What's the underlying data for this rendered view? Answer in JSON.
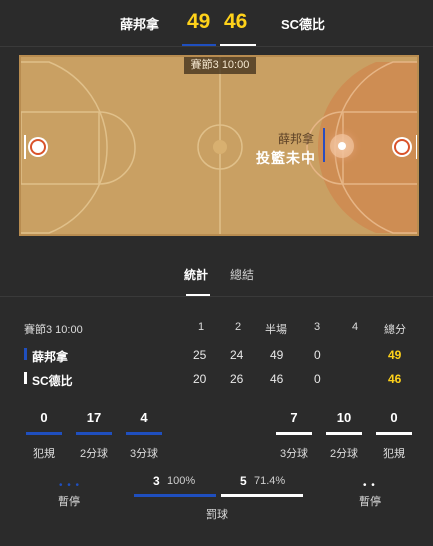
{
  "header": {
    "home_team": "薛邦拿",
    "home_score": "49",
    "away_score": "46",
    "away_team": "SC德比",
    "home_color": "#1f4fbf",
    "away_color": "#ffffff",
    "score_color": "#ffd21a"
  },
  "court": {
    "quarter_tag": "賽節3  10:00",
    "event_team": "薛邦拿",
    "event_text": "投籃未中"
  },
  "tabs": [
    {
      "label": "統計",
      "active": true
    },
    {
      "label": "總結",
      "active": false
    }
  ],
  "table": {
    "period_label": "賽節3  10:00",
    "columns": [
      "1",
      "2",
      "半場",
      "3",
      "4",
      "總分"
    ],
    "rows": [
      {
        "team": "薛邦拿",
        "q1": "25",
        "q2": "24",
        "half": "49",
        "q3": "0",
        "q4": "",
        "total": "49",
        "color": "#1f4fbf"
      },
      {
        "team": "SC德比",
        "q1": "20",
        "q2": "26",
        "half": "46",
        "q3": "0",
        "q4": "",
        "total": "46",
        "color": "#ffffff"
      }
    ]
  },
  "stats": {
    "home": [
      {
        "value": "0",
        "label": "犯規"
      },
      {
        "value": "17",
        "label": "2分球"
      },
      {
        "value": "4",
        "label": "3分球"
      }
    ],
    "away": [
      {
        "value": "7",
        "label": "3分球"
      },
      {
        "value": "10",
        "label": "2分球"
      },
      {
        "value": "0",
        "label": "犯規"
      }
    ]
  },
  "bottom": {
    "home_timeout_label": "暫停",
    "home_timeouts_remaining": 3,
    "away_timeout_label": "暫停",
    "away_timeouts_remaining": 2,
    "home_ft": "3",
    "home_ft_pct": "100%",
    "away_ft": "5",
    "away_ft_pct": "71.4%",
    "ft_label": "罰球"
  }
}
